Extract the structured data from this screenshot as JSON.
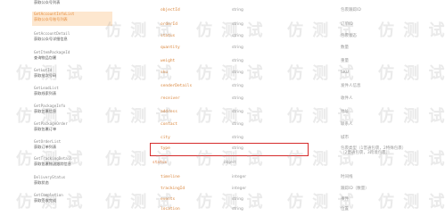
{
  "sidebar": {
    "items": [
      {
        "en": "",
        "zh": "获取公众号列表"
      },
      {
        "en": "GetAccountInfoList",
        "zh": "获取公众号账号列表"
      },
      {
        "en": "GetAccountDetail",
        "zh": "获取公众号详细信息"
      },
      {
        "en": "GetItemPackageId",
        "zh": "查询物品包裹"
      },
      {
        "en": "GetLotId",
        "zh": "获取批次号码"
      },
      {
        "en": "GetLeadList",
        "zh": "获取线索列表"
      },
      {
        "en": "GetPackageInfo",
        "zh": "获取包裹信息"
      },
      {
        "en": "GetPackageOrder",
        "zh": "获取包裹订单"
      },
      {
        "en": "GetOrderList",
        "zh": "获取订单列表"
      },
      {
        "en": "GetTrackingDetail",
        "zh": "获取包裹物流跟踪信息"
      },
      {
        "en": "DeliveryStatus",
        "zh": "获取状态"
      },
      {
        "en": "GetCompletion",
        "zh": "获取签收完成"
      }
    ]
  },
  "table": {
    "rows": [
      {
        "name": "objectId",
        "type": "string",
        "desc": "包裹跟踪ID"
      },
      {
        "name": "orderId",
        "type": "string",
        "desc": "订单ID"
      },
      {
        "name": "status",
        "type": "string",
        "desc": "包裹状态"
      },
      {
        "name": "quantity",
        "type": "string",
        "desc": "数量"
      },
      {
        "name": "weight",
        "type": "string",
        "desc": "重量"
      },
      {
        "name": "sku",
        "type": "string",
        "desc": "SKU"
      },
      {
        "name": "senderDetails",
        "type": "string",
        "desc": "发件人信息"
      },
      {
        "name": "receiver",
        "type": "string",
        "desc": "收件人"
      },
      {
        "name": "address",
        "type": "string",
        "desc": "地址"
      },
      {
        "name": "contact",
        "type": "string",
        "desc": "联系人"
      },
      {
        "name": "city",
        "type": "string",
        "desc": "城市"
      },
      {
        "name": "type",
        "type": "string",
        "desc": "包裹类型（1普通包裹，2特殊包裹）",
        "desc2": "（2普通包裹，3跨境包裹）"
      },
      {
        "name": "status",
        "type": "object",
        "desc": "",
        "sub": true
      },
      {
        "name": "timeline",
        "type": "integer",
        "desc": "时间线"
      },
      {
        "name": "trackingId",
        "type": "integer",
        "desc": "跟踪ID（数量）"
      },
      {
        "name": "events",
        "type": "string",
        "desc": "事件"
      },
      {
        "name": "location",
        "type": "string",
        "desc": "位置"
      },
      {
        "name": "message",
        "type": "string",
        "desc": "消息"
      }
    ]
  },
  "watermark": "仿 测 试",
  "colors": {
    "highlight_box": "#d62b2b",
    "field_name": "#d9853b",
    "active_bg": "#fde7cf"
  }
}
